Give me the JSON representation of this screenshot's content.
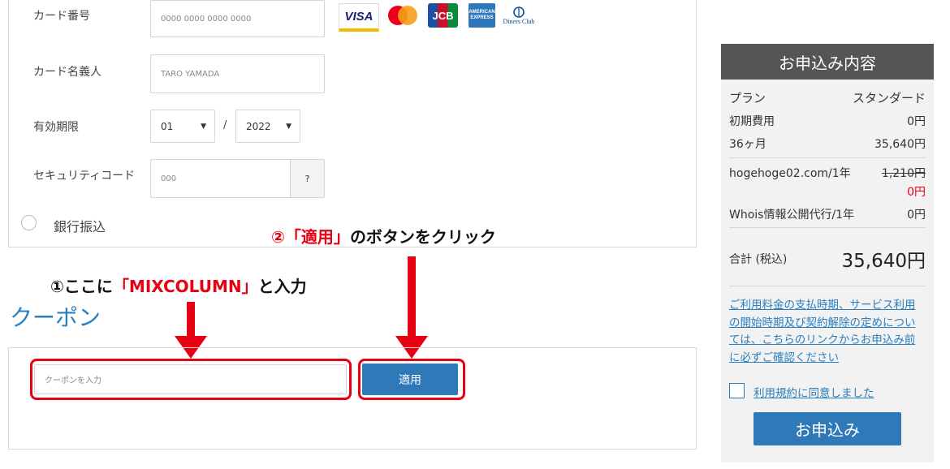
{
  "payment": {
    "card_number_label": "カード番号",
    "card_number_placeholder": "0000 0000 0000 0000",
    "card_holder_label": "カード名義人",
    "card_holder_placeholder": "TARO YAMADA",
    "expiry_label": "有効期限",
    "expiry_month": "01",
    "expiry_separator": "/",
    "expiry_year": "2022",
    "security_label": "セキュリティコード",
    "security_placeholder": "000",
    "security_help": "?",
    "bank_transfer_label": "銀行振込",
    "card_brands": [
      "VISA",
      "Mastercard",
      "JCB",
      "American Express",
      "Diners Club"
    ]
  },
  "coupon": {
    "title": "クーポン",
    "input_placeholder": "クーポンを入力",
    "apply_label": "適用"
  },
  "annotations": {
    "step1_prefix": "①ここに",
    "step1_highlight": "「MIXCOLUMN」",
    "step1_suffix": "と入力",
    "step2_highlight": "②「適用」",
    "step2_suffix": "のボタンをクリック",
    "colors": {
      "highlight": "#e60012"
    }
  },
  "summary": {
    "title": "お申込み内容",
    "plan_label": "プラン",
    "plan_value": "スタンダード",
    "initial_fee_label": "初期費用",
    "initial_fee_value": "0円",
    "term_label": "36ヶ月",
    "term_value": "35,640円",
    "domain_label": "hogehoge02.com/1年",
    "domain_original_price": "1,210円",
    "domain_price": "0円",
    "whois_label": "Whois情報公開代行/1年",
    "whois_value": "0円",
    "total_label": "合計 (税込)",
    "total_value": "35,640円",
    "terms_link": "ご利用料金の支払時期、サービス利用の開始時期及び契約解除の定めについては、こちらのリンクからお申込み前に必ずご確認ください",
    "agree_label": "利用規約に同意しました",
    "submit_label": "お申込み",
    "colors": {
      "accent": "#2f79b8",
      "header": "#555555",
      "price_red": "#e60012"
    }
  }
}
